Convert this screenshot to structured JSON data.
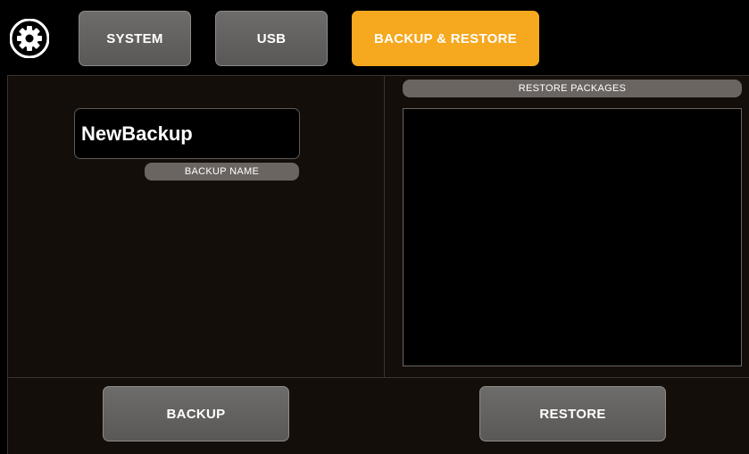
{
  "header": {
    "settings_icon": "gear-icon",
    "tabs": [
      {
        "label": "SYSTEM",
        "active": false
      },
      {
        "label": "USB",
        "active": false
      },
      {
        "label": "BACKUP & RESTORE",
        "active": true
      }
    ]
  },
  "backup": {
    "name_value": "NewBackup",
    "name_label": "BACKUP NAME"
  },
  "restore": {
    "packages_label": "RESTORE PACKAGES",
    "packages": []
  },
  "actions": {
    "backup_label": "BACKUP",
    "restore_label": "RESTORE"
  },
  "colors": {
    "accent": "#f6a81e",
    "button": "#625f5d",
    "panel": "#140e0a",
    "pill": "#6b6561"
  }
}
